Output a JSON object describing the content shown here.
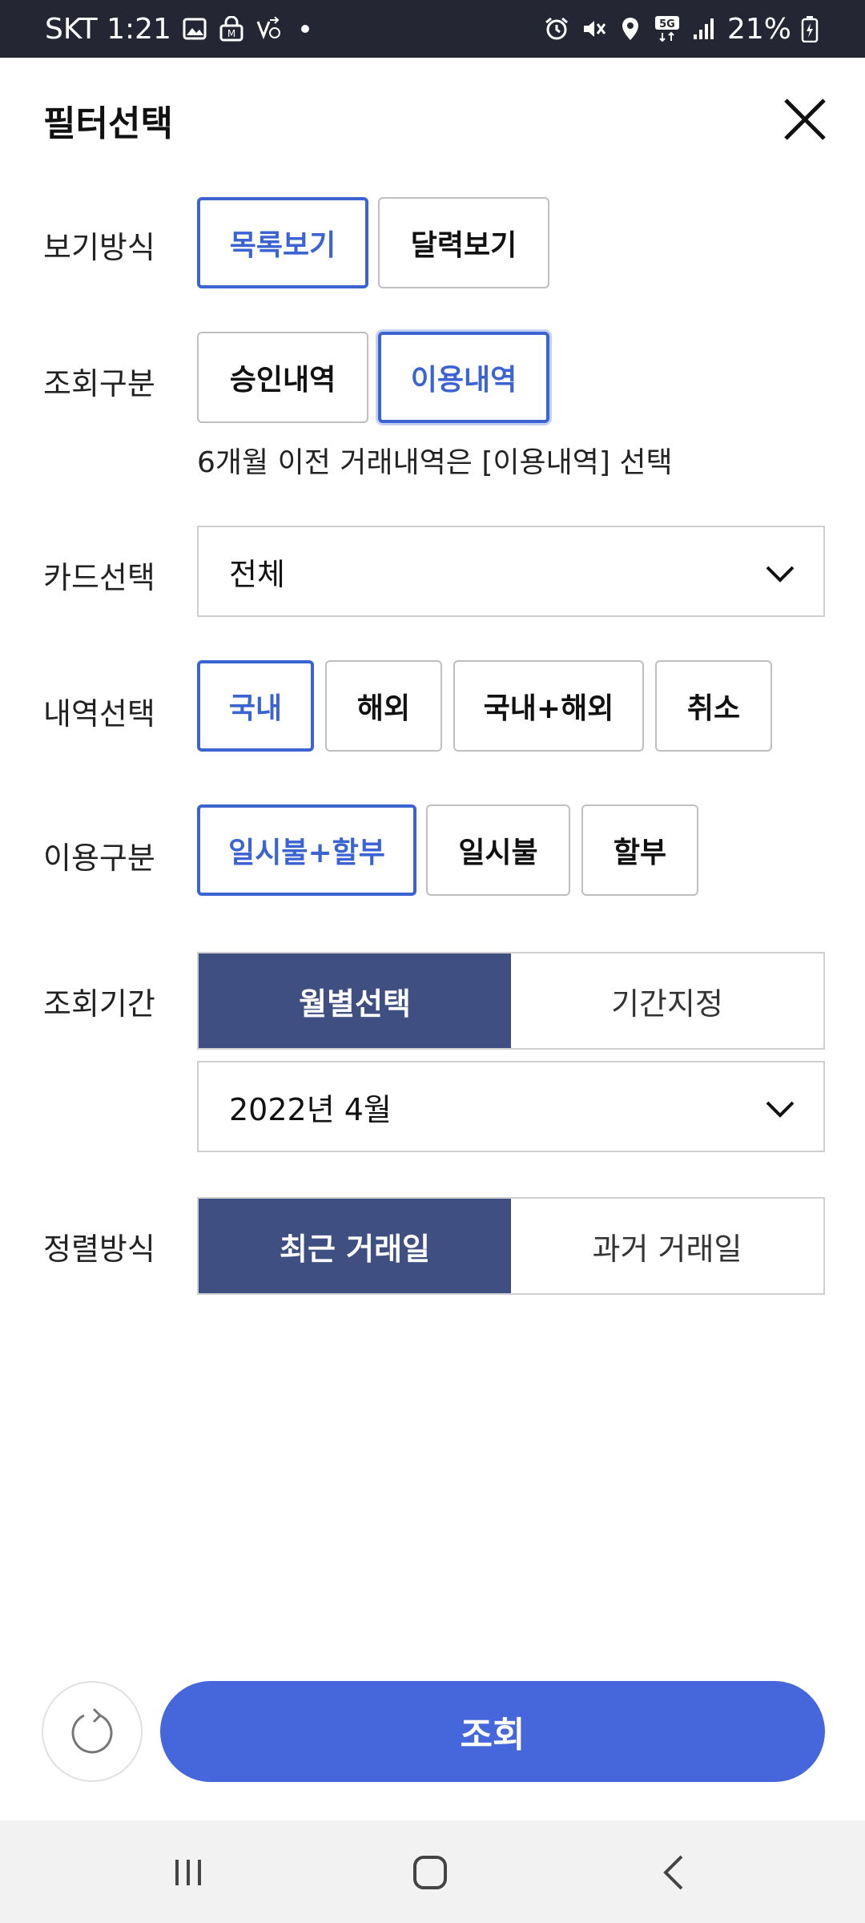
{
  "status_bar": {
    "carrier_time": "SKT 1:21",
    "battery": "21%",
    "left_icons": [
      "image-icon",
      "vpn-lock-icon",
      "call-forward-icon",
      "dot-icon"
    ],
    "right_icons": [
      "alarm-icon",
      "mute-icon",
      "location-icon",
      "5g-icon",
      "signal-icon",
      "battery-icon"
    ]
  },
  "header": {
    "title": "필터선택",
    "close_icon": "close-icon"
  },
  "view_mode": {
    "label": "보기방식",
    "options": [
      "목록보기",
      "달력보기"
    ],
    "selected": "목록보기"
  },
  "query_type": {
    "label": "조회구분",
    "options": [
      "승인내역",
      "이용내역"
    ],
    "selected": "이용내역",
    "note": "6개월 이전 거래내역은 [이용내역] 선택"
  },
  "card_select": {
    "label": "카드선택",
    "value": "전체"
  },
  "history_select": {
    "label": "내역선택",
    "options": [
      "국내",
      "해외",
      "국내+해외",
      "취소"
    ],
    "selected": "국내"
  },
  "usage_type": {
    "label": "이용구분",
    "options": [
      "일시불+할부",
      "일시불",
      "할부"
    ],
    "selected": "일시불+할부"
  },
  "period": {
    "label": "조회기간",
    "options": [
      "월별선택",
      "기간지정"
    ],
    "selected": "월별선택",
    "month_value": "2022년 4월"
  },
  "sort": {
    "label": "정렬방식",
    "options": [
      "최근 거래일",
      "과거 거래일"
    ],
    "selected": "최근 거래일"
  },
  "actions": {
    "submit_label": "조회",
    "refresh_icon": "refresh-icon"
  },
  "colors": {
    "accent": "#4667dc",
    "chip_active": "#3c63d2",
    "segment_active": "#3f4f82",
    "status_bar": "#242633"
  }
}
